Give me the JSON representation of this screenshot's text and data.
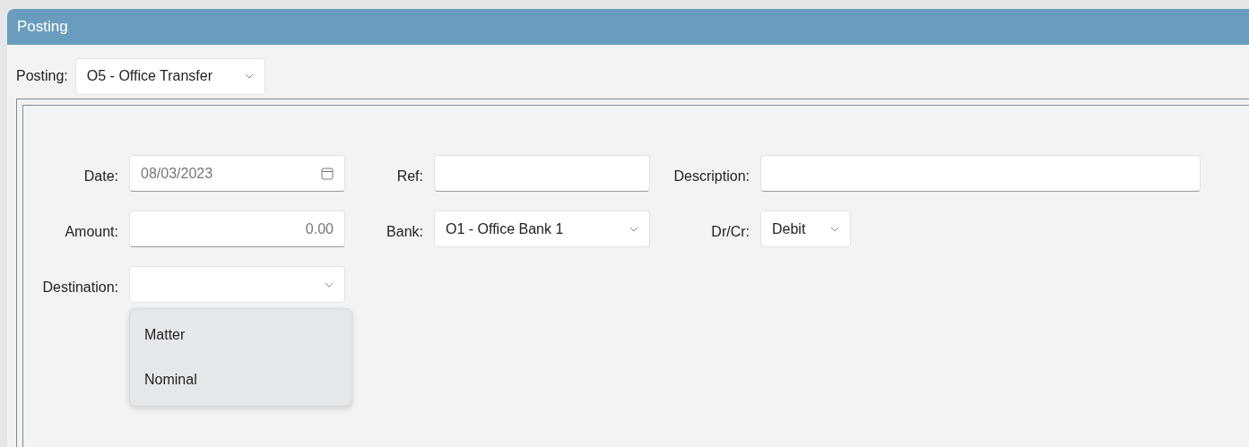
{
  "window": {
    "title": "Posting"
  },
  "posting": {
    "label": "Posting:",
    "value": "O5 - Office Transfer"
  },
  "fields": [
    {
      "kind": "date",
      "label": "Date:",
      "value": "08/03/2023"
    },
    {
      "kind": "text",
      "label": "Ref:"
    },
    {
      "kind": "text",
      "label": "Description:"
    },
    {
      "kind": "number",
      "label": "Amount:",
      "value": "0.00"
    },
    {
      "kind": "select",
      "label": "Bank:",
      "value": "O1 - Office Bank 1"
    },
    {
      "kind": "select",
      "label": "Dr/Cr:",
      "value": "Debit"
    },
    {
      "kind": "select",
      "label": "Destination:",
      "expanded": true,
      "options": [
        {
          "label": "Matter",
          "selected": false
        },
        {
          "label": "Nominal",
          "selected": false
        }
      ]
    }
  ]
}
